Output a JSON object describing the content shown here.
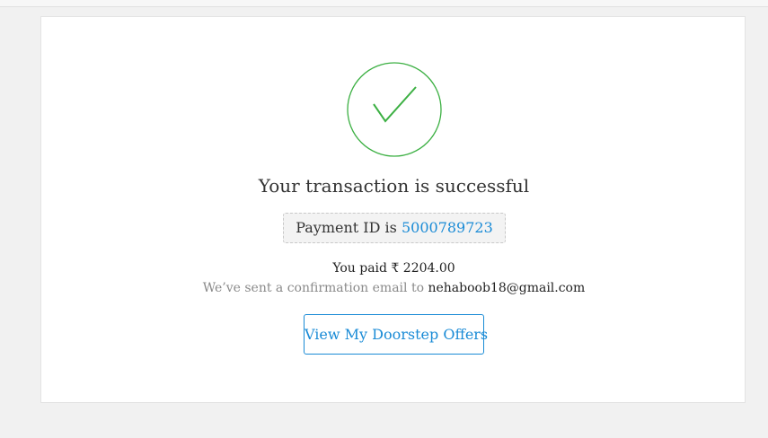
{
  "colors": {
    "accent": "#1a8bd6",
    "success": "#3cb043",
    "page_background": "#f1f1f1",
    "card_background": "#ffffff"
  },
  "status": {
    "icon": "check-circle-icon",
    "title": "Your transaction is successful"
  },
  "payment": {
    "label": "Payment ID is",
    "id": "5000789723"
  },
  "summary": {
    "paid_text": "You paid ₹ 2204.00",
    "email_prefix": "We’ve sent a confirmation email to",
    "email": "nehaboob18@gmail.com"
  },
  "actions": {
    "offers_button_label": "View My Doorstep Offers"
  }
}
